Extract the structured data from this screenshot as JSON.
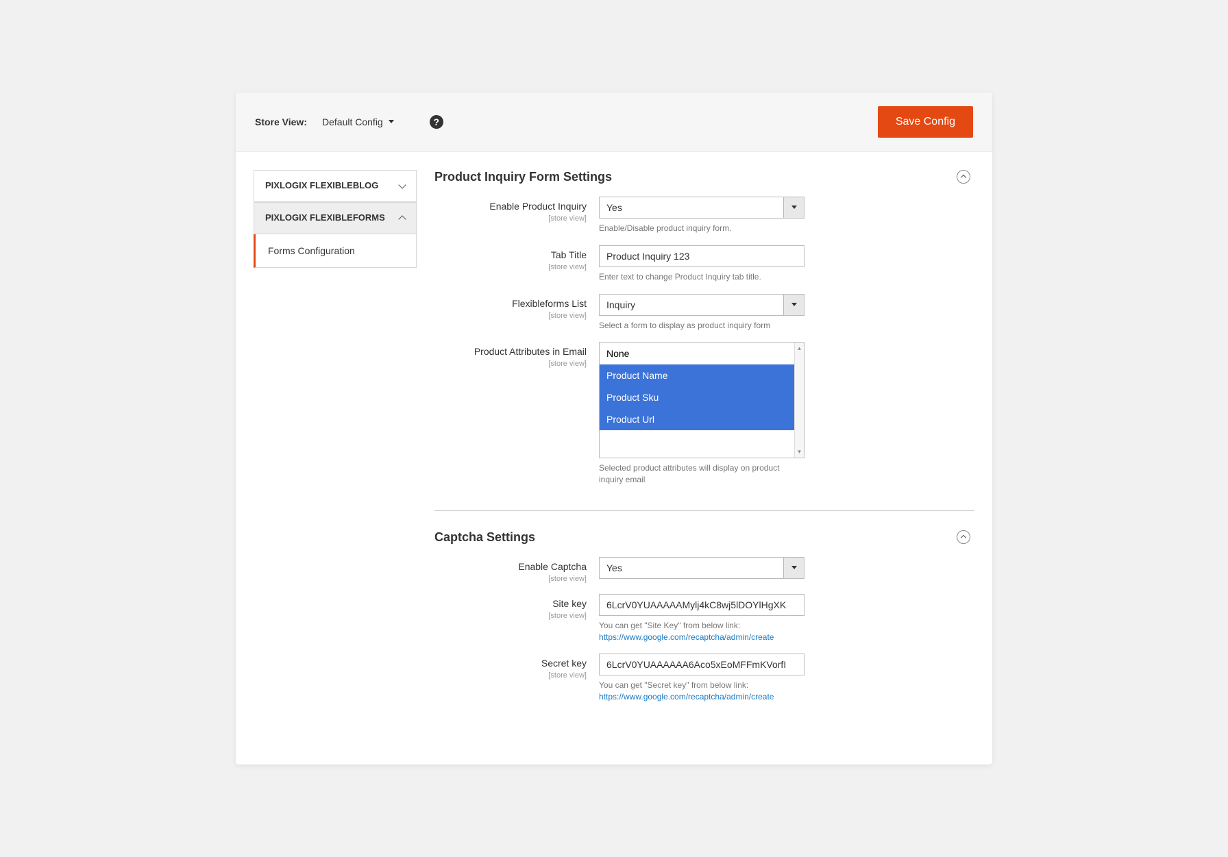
{
  "topbar": {
    "store_view_label": "Store View:",
    "store_view_value": "Default Config",
    "save_button": "Save Config"
  },
  "sidebar": {
    "groups": [
      {
        "title": "PIXLOGIX FLEXIBLEBLOG",
        "expanded": false
      },
      {
        "title": "PIXLOGIX FLEXIBLEFORMS",
        "expanded": true
      }
    ],
    "active_item": "Forms Configuration"
  },
  "sections": {
    "product_inquiry": {
      "title": "Product Inquiry Form Settings",
      "fields": {
        "enable": {
          "label": "Enable Product Inquiry",
          "scope": "[store view]",
          "value": "Yes",
          "note": "Enable/Disable product inquiry form."
        },
        "tab_title": {
          "label": "Tab Title",
          "scope": "[store view]",
          "value": "Product Inquiry 123",
          "note": "Enter text to change Product Inquiry tab title."
        },
        "forms_list": {
          "label": "Flexibleforms List",
          "scope": "[store view]",
          "value": "Inquiry",
          "note": "Select a form to display as product inquiry form"
        },
        "attributes": {
          "label": "Product Attributes in Email",
          "scope": "[store view]",
          "options": [
            {
              "label": "None",
              "selected": false
            },
            {
              "label": "Product Name",
              "selected": true
            },
            {
              "label": "Product Sku",
              "selected": true
            },
            {
              "label": "Product Url",
              "selected": true
            }
          ],
          "note": "Selected product attributes will display on product inquiry email"
        }
      }
    },
    "captcha": {
      "title": "Captcha Settings",
      "fields": {
        "enable": {
          "label": "Enable Captcha",
          "scope": "[store view]",
          "value": "Yes"
        },
        "site_key": {
          "label": "Site key",
          "scope": "[store view]",
          "value": "6LcrV0YUAAAAAMylj4kC8wj5lDOYlHgXK",
          "note_prefix": "You can get \"Site Key\" from below link:",
          "note_link": "https://www.google.com/recaptcha/admin/create"
        },
        "secret_key": {
          "label": "Secret key",
          "scope": "[store view]",
          "value": "6LcrV0YUAAAAAA6Aco5xEoMFFmKVorfI",
          "note_prefix": "You can get \"Secret key\" from below link:",
          "note_link": "https://www.google.com/recaptcha/admin/create"
        }
      }
    }
  }
}
